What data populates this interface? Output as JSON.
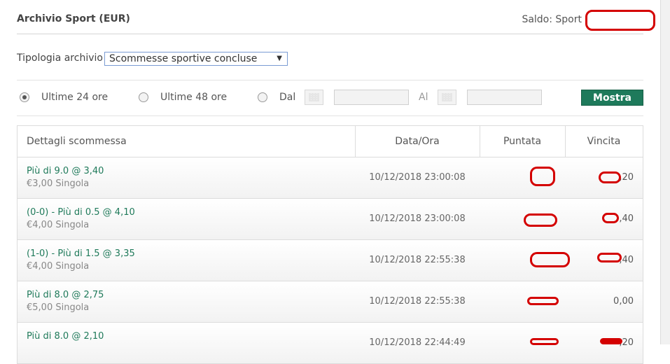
{
  "header": {
    "title": "Archivio Sport (EUR)",
    "saldo_label": "Saldo: Sport"
  },
  "archive_type": {
    "label": "Tipologia archivio",
    "selected": "Scommesse sportive concluse"
  },
  "filters": {
    "last24": "Ultime 24 ore",
    "last48": "Ultime 48 ore",
    "from": "Dal",
    "to": "Al",
    "show_button": "Mostra",
    "selected": "last24"
  },
  "table": {
    "headers": [
      "Dettagli scommessa",
      "Data/Ora",
      "Puntata",
      "Vincita"
    ],
    "rows": [
      {
        "desc": "Più di 9.0 @ 3,40",
        "sub": "€3,00 Singola",
        "date": "10/12/2018 23:00:08",
        "vincita": ",20"
      },
      {
        "desc": "(0-0) - Più di 0.5 @ 4,10",
        "sub": "€4,00 Singola",
        "date": "10/12/2018 23:00:08",
        "vincita": ",40"
      },
      {
        "desc": "(1-0) - Più di 1.5 @ 3,35",
        "sub": "€4,00 Singola",
        "date": "10/12/2018 22:55:38",
        "vincita": ",40"
      },
      {
        "desc": "Più di 8.0 @ 2,75",
        "sub": "€5,00 Singola",
        "date": "10/12/2018 22:55:38",
        "vincita": "0,00"
      },
      {
        "desc": "Più di 8.0 @ 2,10",
        "sub": "",
        "date": "10/12/2018 22:44:49",
        "vincita": ",20"
      }
    ]
  },
  "colors": {
    "accent_green": "#1e7a5b",
    "link_green": "#1f7a5a",
    "redaction_red": "#d40000"
  }
}
